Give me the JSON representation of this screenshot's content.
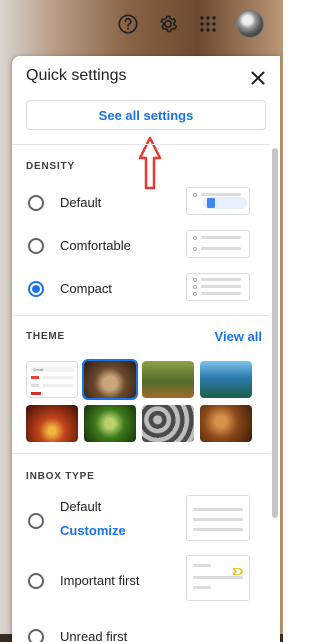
{
  "quick_settings": {
    "title": "Quick settings",
    "see_all_label": "See all settings"
  },
  "density": {
    "title": "DENSITY",
    "options": [
      {
        "label": "Default",
        "selected": false
      },
      {
        "label": "Comfortable",
        "selected": false
      },
      {
        "label": "Compact",
        "selected": true
      }
    ]
  },
  "theme": {
    "title": "THEME",
    "view_all_label": "View all",
    "thumb_colors": [
      "#ffffff",
      "#6b4a2d",
      "#4f6d2d",
      "#2d7ab0",
      "#7a1d0d",
      "#3f7a1d",
      "#4a4a4a",
      "#8a4a1a"
    ],
    "selected_index": 1,
    "gmail_thumb_text": "Gmail"
  },
  "inbox_type": {
    "title": "INBOX TYPE",
    "options": [
      {
        "label": "Default",
        "sub_link": "Customize"
      },
      {
        "label": "Important first"
      },
      {
        "label": "Unread first"
      }
    ]
  },
  "colors": {
    "accent": "#1a73e8",
    "annotation_arrow": "#e53935"
  }
}
